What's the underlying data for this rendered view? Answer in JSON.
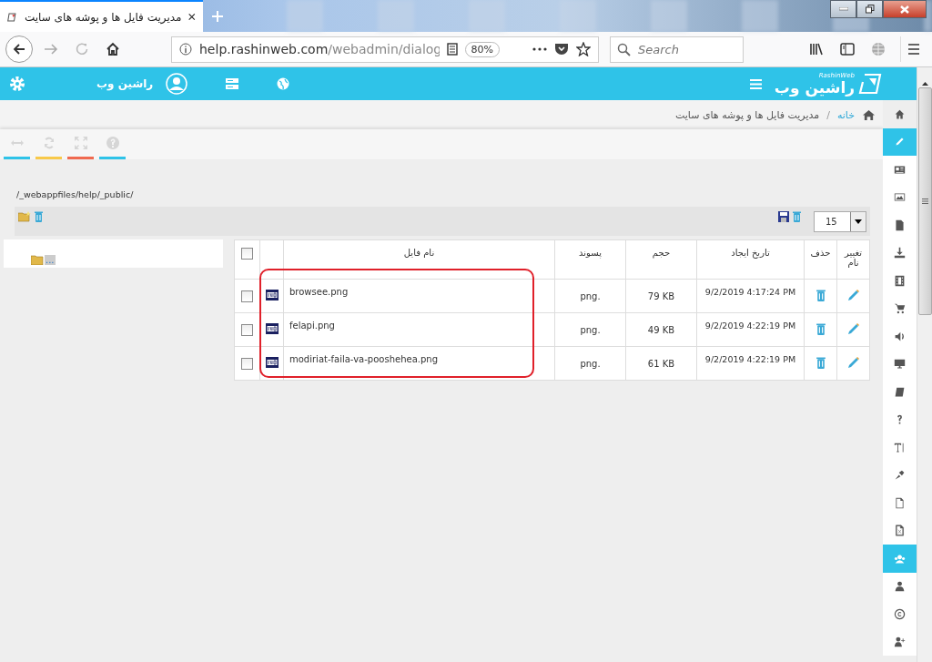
{
  "browser": {
    "tab_title": "مدیریت فایل ها و پوشه های سایت",
    "url_host": "help.rashinweb.com",
    "url_path": "/webadmin/dialog",
    "zoom": "80%",
    "search": {
      "placeholder": "Search"
    }
  },
  "header": {
    "logo_text": "راشین وب",
    "logo_subtext": "RashinWeb",
    "user_name": "راشین وب"
  },
  "breadcrumb": {
    "separator": "/",
    "items": [
      {
        "label": "خانه",
        "kind": "link"
      },
      {
        "label": "مدیریت فایل ها و پوشه های سایت",
        "kind": "current"
      }
    ]
  },
  "toolbar": [
    {
      "kind": "arrows",
      "color": "#2fc3e8"
    },
    {
      "kind": "refresh",
      "color": "#f8c94a"
    },
    {
      "kind": "expand",
      "color": "#f06a50"
    },
    {
      "kind": "help",
      "color": "#2fc3e8"
    }
  ],
  "path": "/_webappfiles/help/_public/",
  "page_size": "15",
  "tree": [
    {
      "label": "..."
    }
  ],
  "table": {
    "all_checked": false,
    "columns": [
      "تغییر نام",
      "حذف",
      "تاریخ ایجاد",
      "حجم",
      "پسوند",
      "نام فایل"
    ],
    "rows": [
      {
        "date": "9/2/2019 4:17:24 PM",
        "size": "79 KB",
        "ext": ".png",
        "name": "browsee.png",
        "checked": false
      },
      {
        "date": "9/2/2019 4:22:19 PM",
        "size": "49 KB",
        "ext": ".png",
        "name": "felapi.png",
        "checked": false
      },
      {
        "date": "9/2/2019 4:22:19 PM",
        "size": "61 KB",
        "ext": ".png",
        "name": "modiriat-faila-va-pooshehea.png",
        "checked": false
      }
    ]
  },
  "sidebar": [
    {
      "kind": "home",
      "selected": false
    },
    {
      "kind": "pencil",
      "selected": true
    },
    {
      "kind": "news",
      "selected": false
    },
    {
      "kind": "image",
      "selected": false
    },
    {
      "kind": "file",
      "selected": false
    },
    {
      "kind": "download",
      "selected": false
    },
    {
      "kind": "film",
      "selected": false
    },
    {
      "kind": "cart",
      "selected": false
    },
    {
      "kind": "speaker",
      "selected": false
    },
    {
      "kind": "monitor",
      "selected": false
    },
    {
      "kind": "book",
      "selected": false
    },
    {
      "kind": "question",
      "selected": false
    },
    {
      "kind": "text",
      "selected": false
    },
    {
      "kind": "pin",
      "selected": false
    },
    {
      "kind": "page",
      "selected": false
    },
    {
      "kind": "excel",
      "selected": false
    },
    {
      "kind": "users",
      "selected": true
    },
    {
      "kind": "user",
      "selected": false
    },
    {
      "kind": "copyright",
      "selected": false
    },
    {
      "kind": "adduser",
      "selected": false
    }
  ]
}
